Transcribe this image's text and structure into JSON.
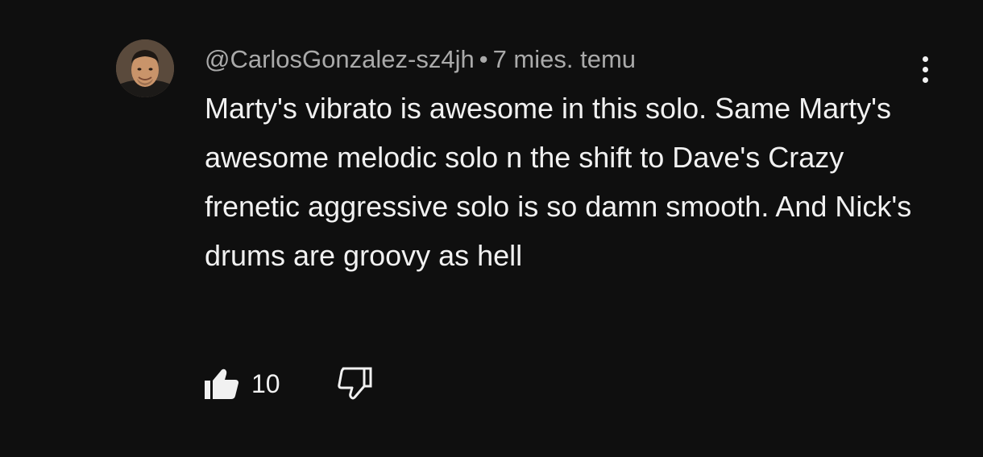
{
  "comment": {
    "author": "@CarlosGonzalez-sz4jh",
    "separator": "•",
    "time_ago": "7 mies. temu",
    "text": "Marty's vibrato is awesome in this solo. Same Marty's awesome melodic solo n the shift to Dave's Crazy frenetic aggressive solo is so damn smooth. And Nick's drums are groovy as hell",
    "like_count": "10"
  },
  "icons": {
    "avatar": "user-avatar-photo",
    "like": "thumbs-up-filled-icon",
    "dislike": "thumbs-down-outline-icon",
    "menu": "more-vertical-icon"
  },
  "colors": {
    "background": "#0f0f0f",
    "text": "#f1f1f1",
    "meta_text": "#aaaaaa"
  }
}
